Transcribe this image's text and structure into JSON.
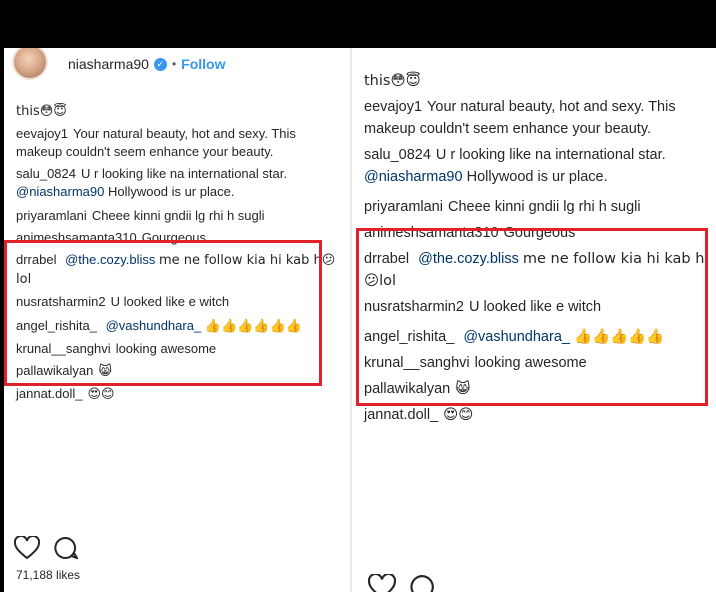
{
  "left": {
    "username": "niasharma90",
    "verified_glyph": "✓",
    "dot": "•",
    "follow_label": "Follow",
    "likes": "71,188 likes",
    "comments": [
      {
        "user": "",
        "text": "this😳😇"
      },
      {
        "user": "eevajoy1",
        "text": "Your natural beauty, hot and sexy. This makeup couldn't seem enhance your beauty."
      },
      {
        "user": "salu_0824",
        "text": "U r looking like na international star.",
        "mention": "@niasharma90",
        "after": "Hollywood is ur place."
      },
      {
        "user": "priyaramlani",
        "text": "Cheee kinni gndii lg rhi h sugli"
      },
      {
        "user": "animeshsamanta310",
        "text": "Gourgeous"
      },
      {
        "user": "drrabel",
        "text": "",
        "mention": "@the.cozy.bliss",
        "after": "me ne follow kia hi kab h😕lol"
      },
      {
        "user": "nusratsharmin2",
        "text": "U looked like e witch"
      },
      {
        "user": "angel_rishita_",
        "text": "",
        "mention": "@vashundhara_",
        "after": "👍👍👍👍👍👍"
      },
      {
        "user": "krunal__sanghvi",
        "text": "looking awesome"
      },
      {
        "user": "pallawikalyan",
        "text": "😸"
      },
      {
        "user": "jannat.doll_",
        "text": "😍😊"
      }
    ]
  },
  "right": {
    "comments": [
      {
        "user": "",
        "text": "this😳😇"
      },
      {
        "user": "eevajoy1",
        "text": "Your natural beauty, hot and sexy. This makeup couldn't seem enhance your beauty."
      },
      {
        "user": "salu_0824",
        "text": "U r looking like na international star.",
        "mention": "@niasharma90",
        "after": "Hollywood is ur place."
      },
      {
        "user": "priyaramlani",
        "text": "Cheee kinni gndii lg rhi h sugli"
      },
      {
        "user": "animeshsamanta310",
        "text": "Gourgeous"
      },
      {
        "user": "drrabel",
        "text": "",
        "mention": "@the.cozy.bliss",
        "after": "me ne follow kia hi kab h😕lol"
      },
      {
        "user": "nusratsharmin2",
        "text": "U looked like e witch"
      },
      {
        "user": "angel_rishita_",
        "text": "",
        "mention": "@vashundhara_",
        "after": "👍👍👍👍👍"
      },
      {
        "user": "krunal__sanghvi",
        "text": "looking awesome"
      },
      {
        "user": "pallawikalyan",
        "text": "😸"
      },
      {
        "user": "jannat.doll_",
        "text": "😍😊"
      }
    ]
  },
  "colors": {
    "highlight": "#e0202b",
    "link": "#3897f0",
    "mention": "#003569"
  },
  "icons": [
    "heart-icon",
    "comment-icon",
    "verified-badge-icon"
  ]
}
